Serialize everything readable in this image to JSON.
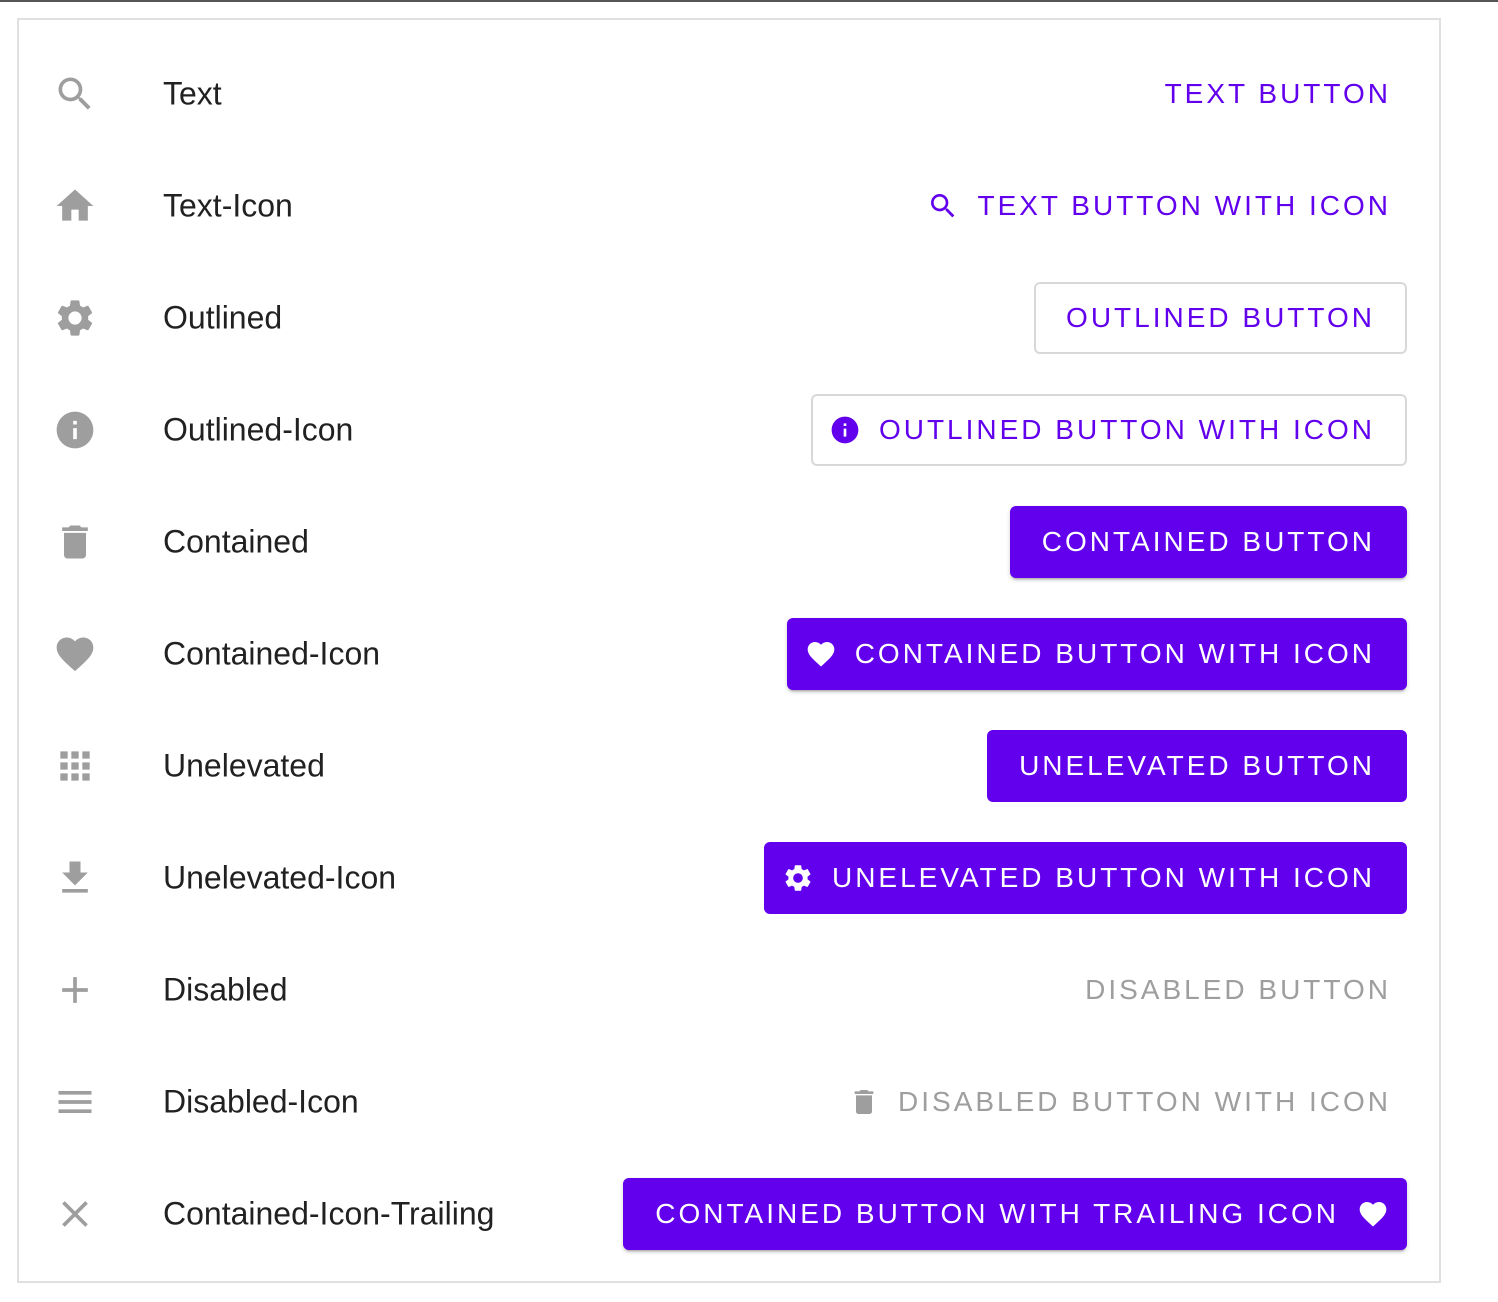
{
  "theme": {
    "primary": "#6200ee",
    "icon_gray": "#9e9e9e",
    "text": "#212121",
    "disabled_text": "#9e9e9e",
    "outline_border": "#d8d8d8"
  },
  "rows": [
    {
      "label": "Text",
      "lead_icon": "search-icon",
      "button": {
        "label": "TEXT BUTTON",
        "variant": "text",
        "icon": null
      }
    },
    {
      "label": "Text-Icon",
      "lead_icon": "home-icon",
      "button": {
        "label": "TEXT BUTTON WITH ICON",
        "variant": "text",
        "icon": "search-icon"
      }
    },
    {
      "label": "Outlined",
      "lead_icon": "gear-icon",
      "button": {
        "label": "OUTLINED BUTTON",
        "variant": "outlined",
        "icon": null
      }
    },
    {
      "label": "Outlined-Icon",
      "lead_icon": "info-icon",
      "button": {
        "label": "OUTLINED BUTTON WITH ICON",
        "variant": "outlined",
        "icon": "info-icon"
      }
    },
    {
      "label": "Contained",
      "lead_icon": "trash-icon",
      "button": {
        "label": "CONTAINED BUTTON",
        "variant": "contained",
        "icon": null
      }
    },
    {
      "label": "Contained-Icon",
      "lead_icon": "heart-icon",
      "button": {
        "label": "CONTAINED BUTTON WITH ICON",
        "variant": "contained",
        "icon": "heart-icon"
      }
    },
    {
      "label": "Unelevated",
      "lead_icon": "grid-icon",
      "button": {
        "label": "UNELEVATED BUTTON",
        "variant": "unelevated",
        "icon": null
      }
    },
    {
      "label": "Unelevated-Icon",
      "lead_icon": "download-icon",
      "button": {
        "label": "UNELEVATED BUTTON WITH ICON",
        "variant": "unelevated",
        "icon": "gear-icon"
      }
    },
    {
      "label": "Disabled",
      "lead_icon": "plus-icon",
      "button": {
        "label": "DISABLED BUTTON",
        "variant": "disabled",
        "icon": null
      }
    },
    {
      "label": "Disabled-Icon",
      "lead_icon": "menu-icon",
      "button": {
        "label": "DISABLED BUTTON WITH ICON",
        "variant": "disabled",
        "icon": "trash-icon"
      }
    },
    {
      "label": "Contained-Icon-Trailing",
      "lead_icon": "close-icon",
      "button": {
        "label": "CONTAINED BUTTON WITH TRAILING ICON",
        "variant": "contained",
        "icon": "heart-icon",
        "icon_position": "trailing"
      }
    }
  ]
}
